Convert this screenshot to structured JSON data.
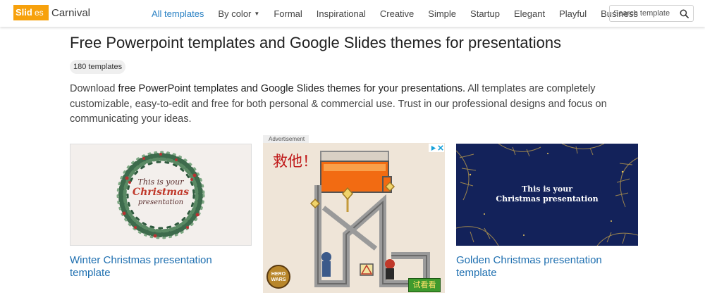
{
  "brand": {
    "part1": "Slid",
    "part2": "es",
    "part3": "Carnival"
  },
  "nav": {
    "items": [
      {
        "label": "All templates",
        "active": true
      },
      {
        "label": "By color",
        "active": false,
        "dropdown": true
      },
      {
        "label": "Formal",
        "active": false
      },
      {
        "label": "Inspirational",
        "active": false
      },
      {
        "label": "Creative",
        "active": false
      },
      {
        "label": "Simple",
        "active": false
      },
      {
        "label": "Startup",
        "active": false
      },
      {
        "label": "Elegant",
        "active": false
      },
      {
        "label": "Playful",
        "active": false
      },
      {
        "label": "Business",
        "active": false
      }
    ]
  },
  "search": {
    "placeholder": "Search template"
  },
  "page": {
    "title": "Free Powerpoint templates and Google Slides themes for presentations",
    "count": "180 templates",
    "intro_start": "Download ",
    "intro_bold": "free PowerPoint templates and Google Slides themes for your presentations.",
    "intro_rest": " All templates are completely customizable, easy-to-edit and free for both personal & commercial use. Trust in our professional designs and focus on communicating your ideas."
  },
  "cards": [
    {
      "title": "Winter Christmas presentation template",
      "thumb_line1": "This is your",
      "thumb_line2": "Christmas",
      "thumb_line3": "presentation"
    },
    {
      "title": "Golden Christmas presentation template",
      "thumb_line1": "This is your",
      "thumb_line2": "Christmas presentation"
    }
  ],
  "ad": {
    "label": "Advertisement",
    "headline": "救他！",
    "cta": "试看看",
    "game_logo": "HERO WARS"
  },
  "colors": {
    "accent": "#2b82c4",
    "link": "#1e6fb0",
    "brand": "#f7a10c",
    "winter_red": "#c0392b",
    "golden_bg": "#13225a"
  }
}
